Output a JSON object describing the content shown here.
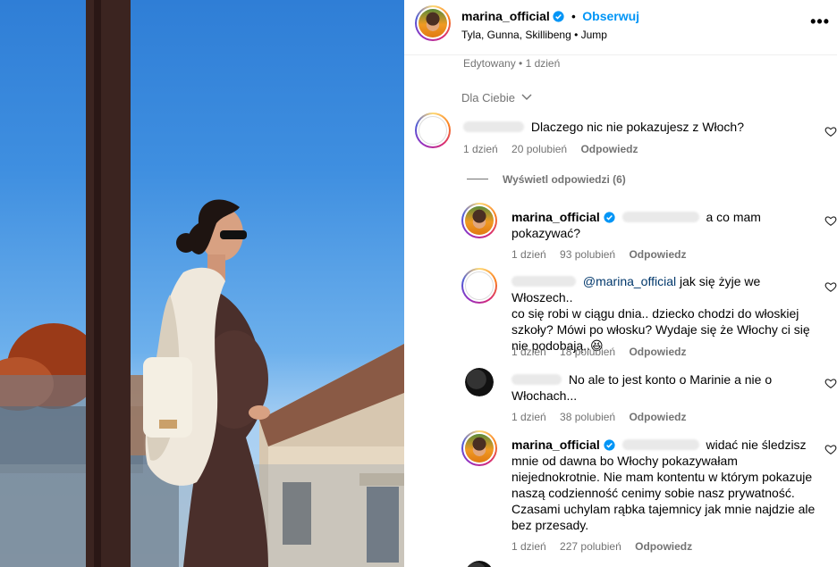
{
  "post": {
    "username": "marina_official",
    "separator": "•",
    "follow_label": "Obserwuj",
    "music": "Tyla, Gunna, Skillibeng • Jump",
    "edited": "Edytowany • 1 dzień",
    "sort_label": "Dla Ciebie"
  },
  "comments": [
    {
      "username": "",
      "text": "Dlaczego nic nie pokazujesz z Włoch?",
      "time": "1 dzień",
      "likes": "20 polubień",
      "reply": "Odpowiedz",
      "view_replies": "Wyświetl odpowiedzi (6)"
    }
  ],
  "replies": [
    {
      "username": "marina_official",
      "line1": "a co mam",
      "line2": "pokazywać?",
      "time": "1 dzień",
      "likes": "93 polubień",
      "reply": "Odpowiedz"
    },
    {
      "username": "",
      "mention": "@marina_official",
      "line1": "jak się żyje we Włoszech..",
      "line2": "co się robi w ciągu dnia.. dziecko chodzi do włoskiej",
      "line3": "szkoły? Mówi po włosku? Wydaje się że Włochy ci się",
      "line4": "nie podobają..😆",
      "time": "1 dzień",
      "likes": "18 polubień",
      "reply": "Odpowiedz"
    },
    {
      "username": "",
      "line1": "No ale to jest konto o Marinie a nie o",
      "line2": "Włochach...",
      "time": "1 dzień",
      "likes": "38 polubień",
      "reply": "Odpowiedz"
    },
    {
      "username": "marina_official",
      "line1": "widać nie śledzisz",
      "line2": "mnie od dawna bo Włochy pokazywałam",
      "line3": "niejednokrotnie. Nie mam kontentu w którym pokazuje",
      "line4": "naszą codzienność cenimy sobie nasz prywatność.",
      "line5": "Czasami uchylam rąbka tajemnicy jak mnie najdzie ale",
      "line6": "bez przesady.",
      "time": "1 dzień",
      "likes": "227 polubień",
      "reply": "Odpowiedz"
    }
  ],
  "colors": {
    "accent": "#0095f6",
    "muted": "#737373",
    "mention": "#00376b",
    "verified": "#0095f6"
  },
  "icons": [
    "verified-badge-icon",
    "more-options-icon",
    "chevron-down-icon",
    "heart-icon"
  ]
}
